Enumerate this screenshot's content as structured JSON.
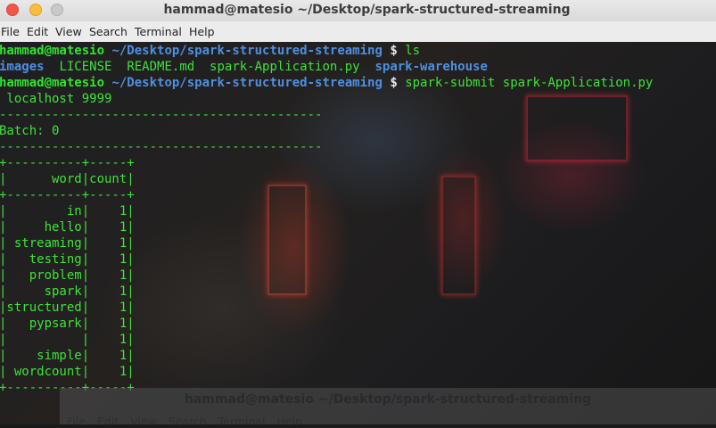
{
  "window": {
    "title": "hammad@matesio ~/Desktop/spark-structured-streaming"
  },
  "menu": [
    "File",
    "Edit",
    "View",
    "Search",
    "Terminal",
    "Help"
  ],
  "terminal": {
    "prompt_user": "hammad@matesio",
    "prompt_path": "~/Desktop/spark-structured-streaming",
    "prompt_symbol": "$",
    "cmd1": "ls",
    "ls_items": [
      "images",
      "LICENSE",
      "README.md",
      "spark-Application.py",
      "spark-warehouse"
    ],
    "cmd2": "spark-submit spark-Application.py",
    "arg_line": " localhost 9999",
    "separator": "-------------------------------------------",
    "batch": "Batch: 0",
    "table_border": "+----------+-----+",
    "table_header": "|      word|count|",
    "rows": [
      "|        in|    1|",
      "|     hello|    1|",
      "| streaming|    1|",
      "|   testing|    1|",
      "|   problem|    1|",
      "|     spark|    1|",
      "|structured|    1|",
      "|   pypsark|    1|",
      "|          |    1|",
      "|    simple|    1|",
      "| wordcount|    1|"
    ]
  },
  "background_window": {
    "title": "hammad@matesio ~/Desktop/spark-structured-streaming",
    "menu": [
      "File",
      "Edit",
      "View",
      "Search",
      "Terminal",
      "Help"
    ]
  }
}
